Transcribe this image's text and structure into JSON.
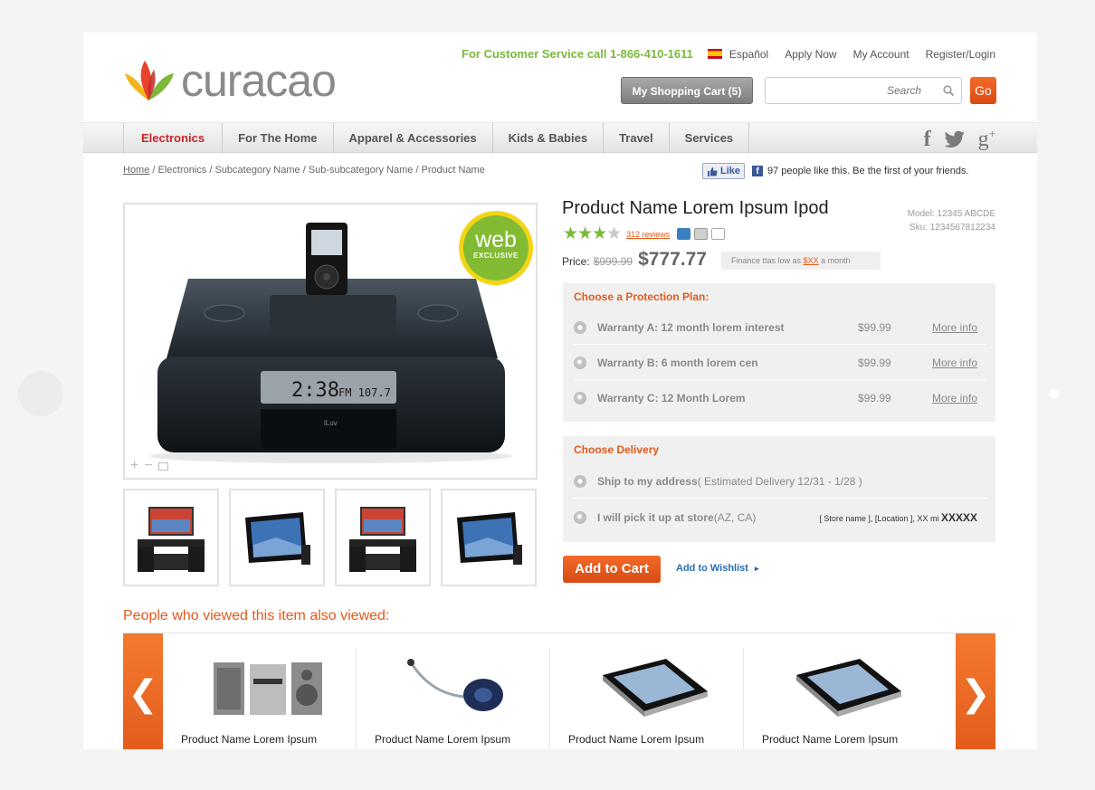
{
  "header": {
    "logo_text": "curacao",
    "customer_service": "For Customer Service call 1-866-410-1611",
    "language": "Español",
    "links": [
      "Apply Now",
      "My Account",
      "Register/Login"
    ],
    "cart_label": "My Shopping Cart (5)",
    "search_placeholder": "Search",
    "go_label": "Go"
  },
  "nav": {
    "items": [
      "Electronics",
      "For The Home",
      "Apparel & Accessories",
      "Kids & Babies",
      "Travel",
      "Services"
    ],
    "active": "Electronics",
    "social_icons": [
      "facebook-icon",
      "twitter-icon",
      "google-plus-icon"
    ],
    "gplus_label": "g",
    "gplus_sup": "+",
    "fb_label": "f"
  },
  "breadcrumb": {
    "home": "Home",
    "rest": " / Electronics / Subcategory Name / Sub-subcategory Name / Product Name"
  },
  "facebook": {
    "like_label": "Like",
    "count_text": "97 people like this. Be the first of your friends."
  },
  "product": {
    "badge_main": "web",
    "badge_sub": "EXCLUSIVE",
    "title": "Product Name Lorem Ipsum Ipod",
    "model": "Model: 12345 ABCDE",
    "sku": "Sku: 1234567812234",
    "rating": 3.5,
    "rating_max": 5,
    "reviews": "312 reviews",
    "price_label": "Price:",
    "old_price": "$999.99",
    "new_price": "$777.77",
    "finance_pre": "Finance ttas low as ",
    "finance_amt": "$XX",
    "finance_post": " a month",
    "display_time": "2:38",
    "display_freq": "FM 107.7",
    "brand": "iLuv"
  },
  "protection": {
    "heading": "Choose a Protection Plan:",
    "options": [
      {
        "label": "Warranty A: 12 month lorem interest",
        "price": "$99.99",
        "more": "More info"
      },
      {
        "label": "Warranty B: 6 month lorem cen",
        "price": "$99.99",
        "more": "More info"
      },
      {
        "label": "Warranty C: 12 Month Lorem",
        "price": "$99.99",
        "more": "More info"
      }
    ]
  },
  "delivery": {
    "heading": "Choose Delivery",
    "ship_label": "Ship to my address",
    "ship_est": " ( Estimated Delivery 12/31 - 1/28 )",
    "pickup_label": "I will pick it up at store",
    "pickup_state": " (AZ, CA)",
    "store_info": "[ Store name ], [Location ],  XX mi  ",
    "store_code": "XXXXX"
  },
  "actions": {
    "add_to_cart": "Add to Cart",
    "wishlist": "Add to Wishlist"
  },
  "also_viewed": {
    "title": "People who viewed this item also viewed:",
    "prev": "❮",
    "next": "❯",
    "items": [
      {
        "name": "Product Name Lorem Ipsum"
      },
      {
        "name": "Product Name Lorem Ipsum"
      },
      {
        "name": "Product Name Lorem Ipsum"
      },
      {
        "name": "Product Name Lorem Ipsum"
      }
    ]
  },
  "colors": {
    "accent_orange": "#e25a1c",
    "accent_green": "#7cb83a",
    "nav_active": "#c8262a"
  }
}
